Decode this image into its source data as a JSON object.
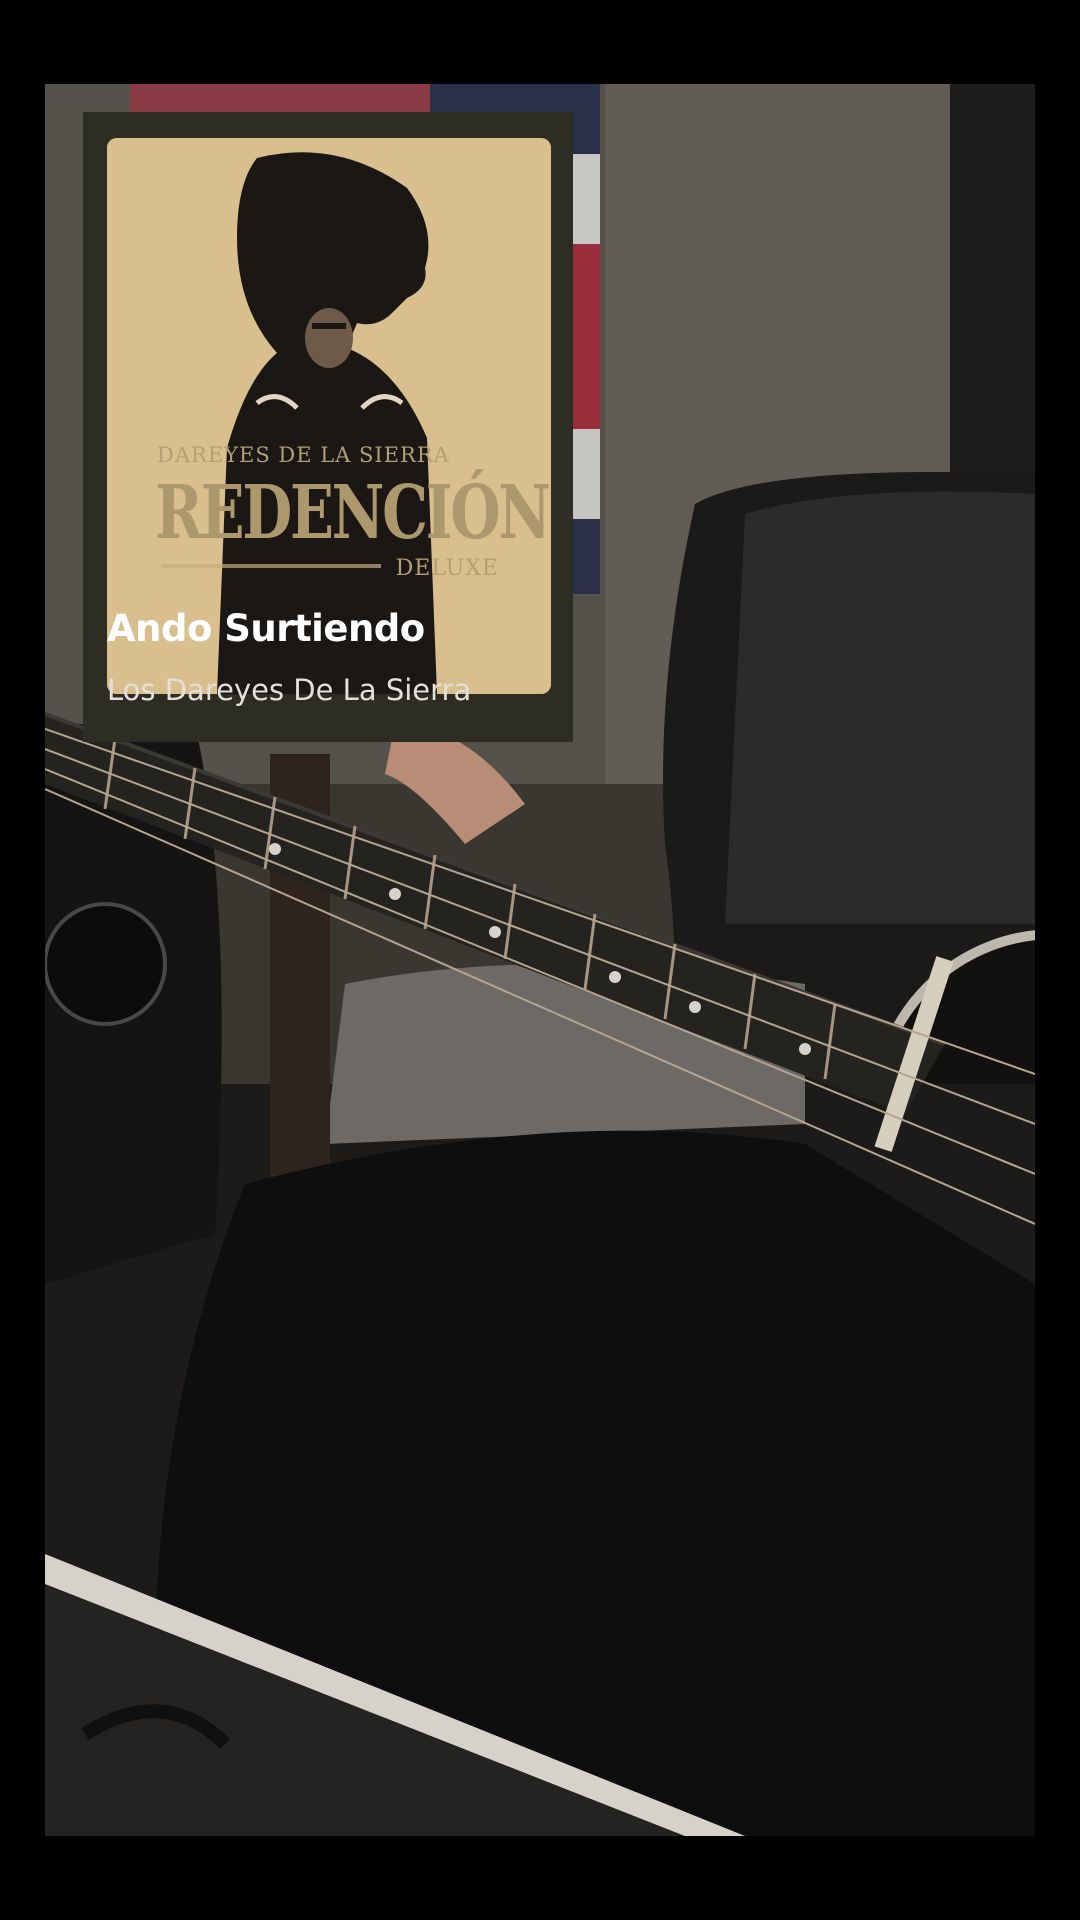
{
  "track": {
    "title": "Ando Surtiendo",
    "artist": "Los Dareyes De La Sierra"
  },
  "album_cover": {
    "kicker": "DAREYES DE LA SIERRA",
    "title": "REDENCIÓN",
    "edition": "DELUXE"
  },
  "colors": {
    "card_background": "#2e2d24",
    "cover_background": "#d9bf8e",
    "title_text": "#ffffff",
    "artist_text": "#e2e0d8"
  }
}
